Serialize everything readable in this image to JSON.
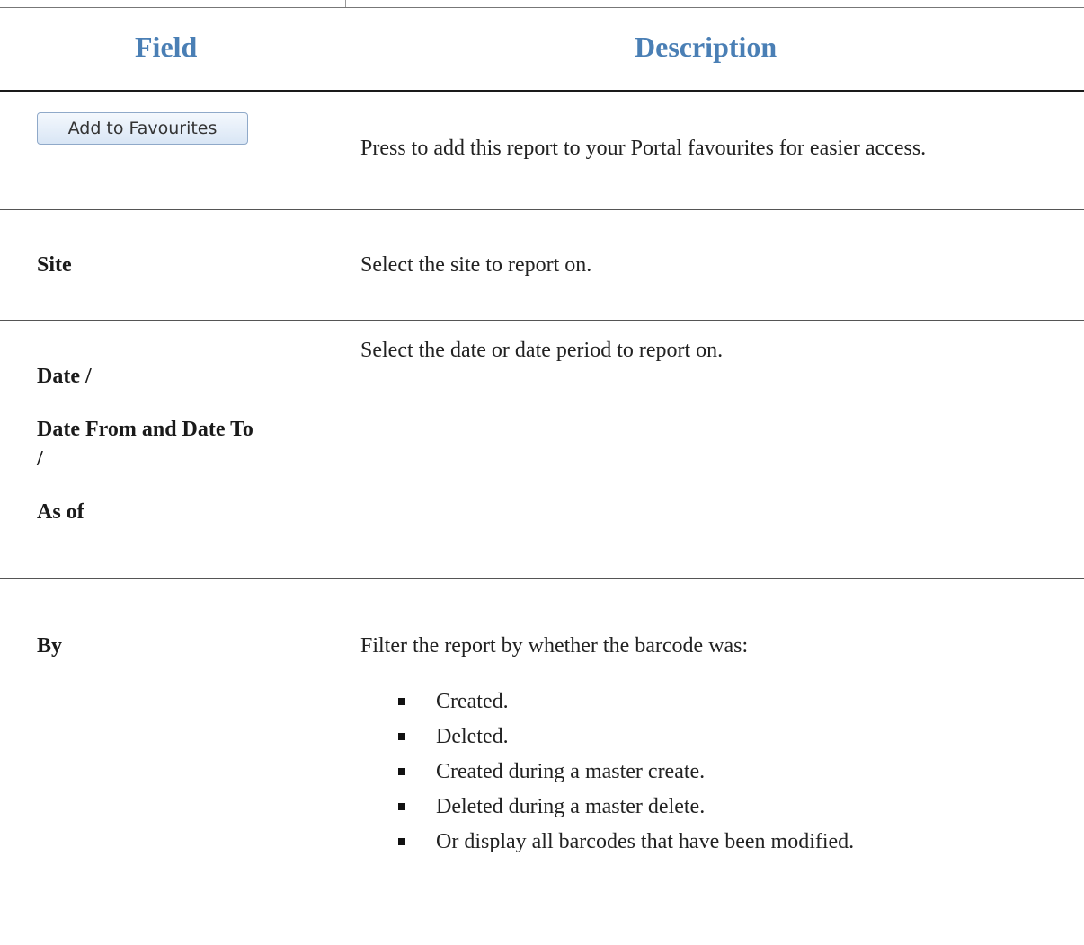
{
  "headers": {
    "field": "Field",
    "description": "Description"
  },
  "rows": {
    "favourites": {
      "button_label": "Add to Favourites",
      "description": "Press to add this report to your Portal favourites for easier access."
    },
    "site": {
      "field": "Site",
      "description": "Select the site to report on."
    },
    "date": {
      "field_line1": "Date /",
      "field_line2": "Date From and Date To",
      "field_line3": "/",
      "field_line4": "As of",
      "description": "Select the date or date period to report on."
    },
    "by": {
      "field": "By",
      "description": "Filter the report by whether the barcode was:",
      "options": [
        "Created.",
        "Deleted.",
        "Created during a master create.",
        "Deleted during a master delete.",
        "Or display all barcodes that have been modified."
      ]
    }
  }
}
